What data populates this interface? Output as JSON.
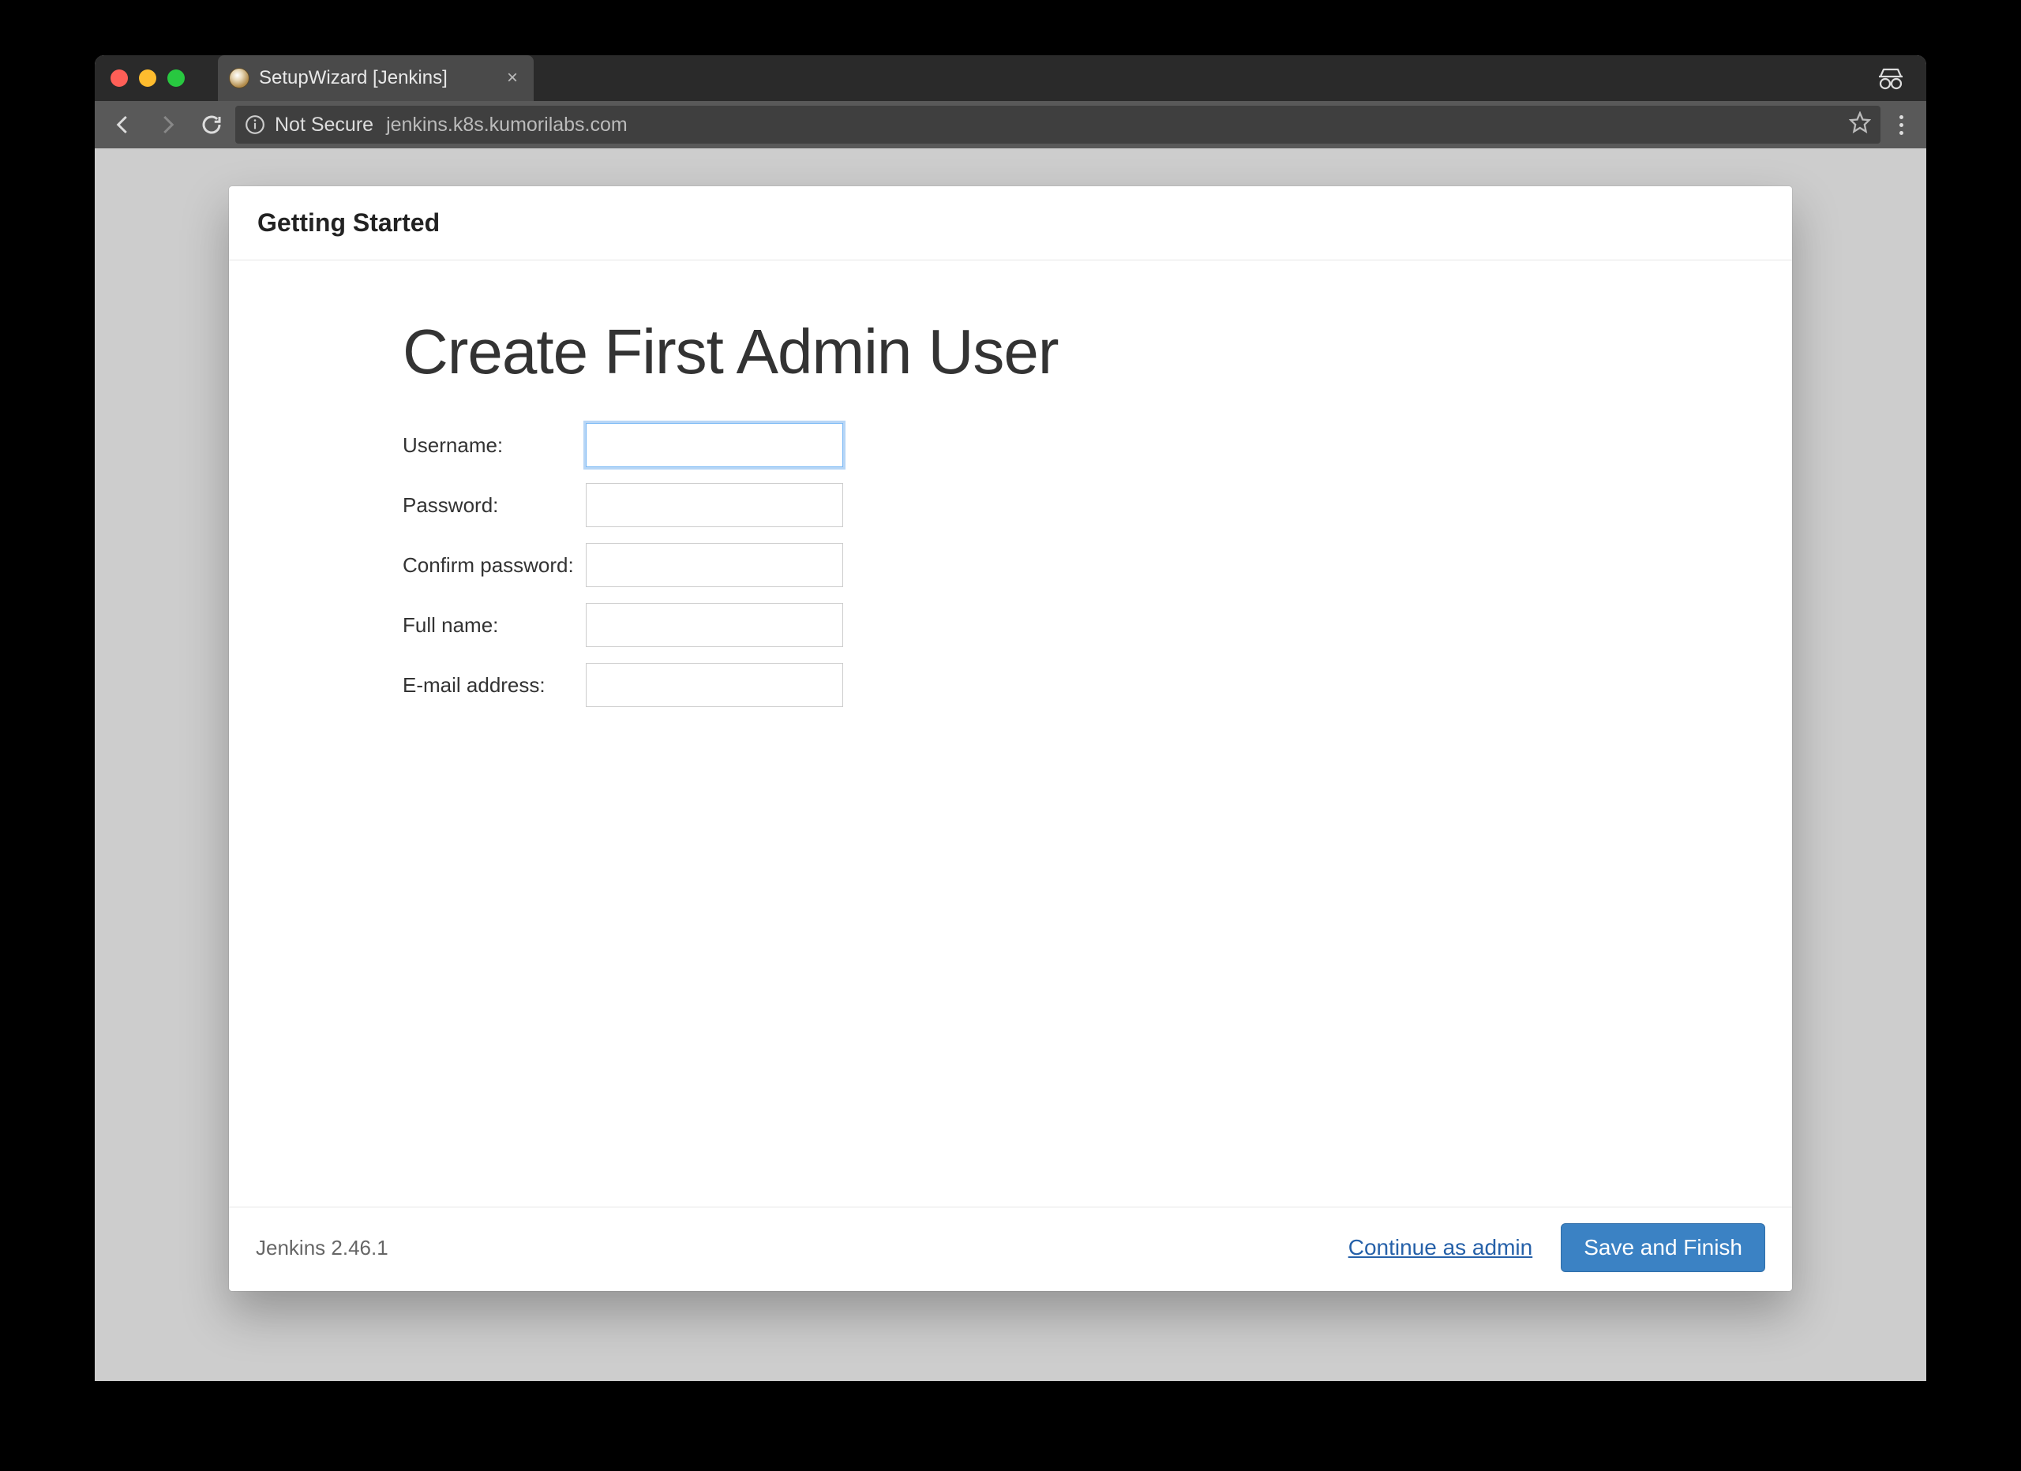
{
  "browser": {
    "tab_title": "SetupWizard [Jenkins]",
    "not_secure_label": "Not Secure",
    "url": "jenkins.k8s.kumorilabs.com"
  },
  "panel": {
    "header": "Getting Started",
    "title": "Create First Admin User"
  },
  "form": {
    "username_label": "Username:",
    "username_value": "",
    "password_label": "Password:",
    "password_value": "",
    "confirm_label": "Confirm password:",
    "confirm_value": "",
    "fullname_label": "Full name:",
    "fullname_value": "",
    "email_label": "E-mail address:",
    "email_value": ""
  },
  "footer": {
    "version": "Jenkins 2.46.1",
    "continue_label": "Continue as admin",
    "save_label": "Save and Finish"
  }
}
